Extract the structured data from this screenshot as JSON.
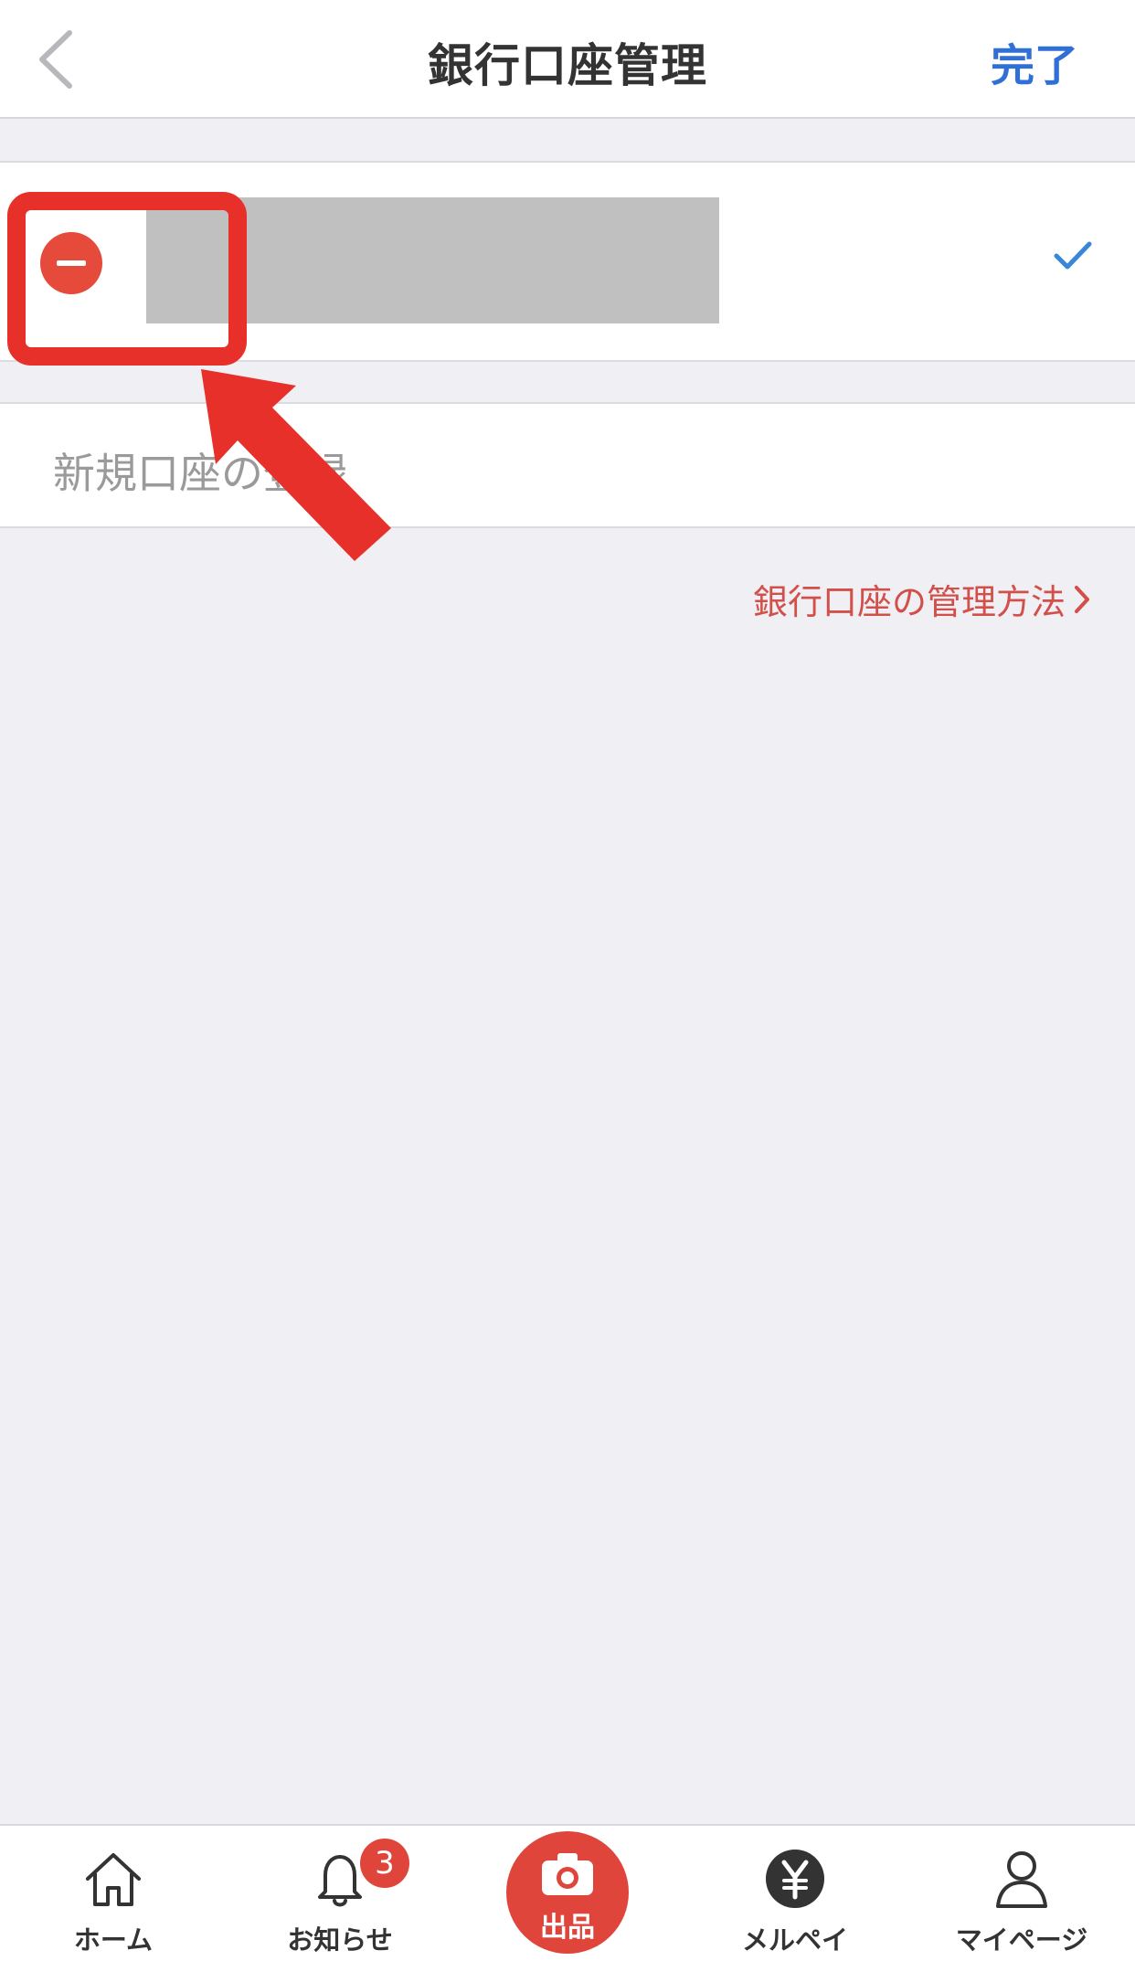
{
  "header": {
    "title": "銀行口座管理",
    "done_label": "完了"
  },
  "account": {
    "redacted": true
  },
  "new_account": {
    "label": "新規口座の登録"
  },
  "help_link": {
    "label": "銀行口座の管理方法"
  },
  "tabbar": {
    "items": [
      {
        "label": "ホーム",
        "icon": "home-icon"
      },
      {
        "label": "お知らせ",
        "icon": "bell-icon",
        "badge": "3"
      },
      {
        "label": "出品",
        "icon": "camera-icon"
      },
      {
        "label": "メルペイ",
        "icon": "yen-icon"
      },
      {
        "label": "マイページ",
        "icon": "person-icon"
      }
    ]
  },
  "colors": {
    "accent_blue": "#2f6fd6",
    "brand_red": "#e0453b",
    "background": "#efeff4"
  }
}
